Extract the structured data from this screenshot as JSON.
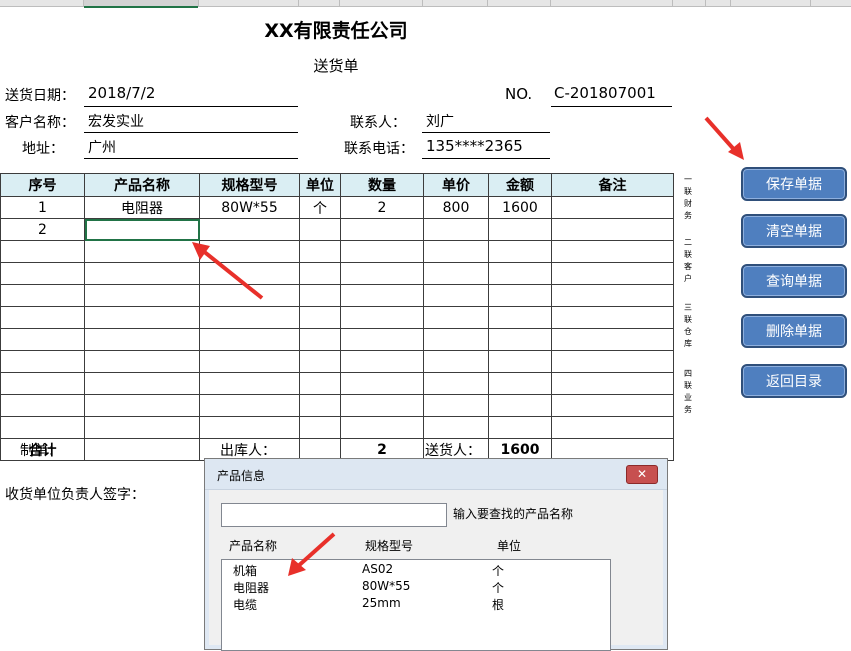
{
  "form": {
    "company": "XX有限责任公司",
    "doc_title": "送货单",
    "date_label": "送货日期：",
    "date_value": "2018/7/2",
    "no_label": "NO.",
    "no_value": "C-201807001",
    "customer_label": "客户名称：",
    "customer_value": "宏发实业",
    "contact_label": "联系人：",
    "contact_value": "刘广",
    "address_label": "地址：",
    "address_value": "广州",
    "phone_label": "联系电话：",
    "phone_value": "135****2365"
  },
  "table": {
    "headers": [
      "序号",
      "产品名称",
      "规格型号",
      "单位",
      "数量",
      "单价",
      "金额",
      "备注"
    ],
    "rows": [
      [
        "1",
        "电阻器",
        "80W*55",
        "个",
        "2",
        "800",
        "1600",
        ""
      ],
      [
        "2",
        "",
        "",
        "",
        "",
        "",
        "",
        ""
      ]
    ],
    "total_label": "合计",
    "total_qty": "2",
    "total_amount": "1600"
  },
  "side_labels": {
    "a": [
      "一",
      "联",
      "财",
      "务"
    ],
    "b": [
      "二",
      "联",
      "客",
      "户"
    ],
    "c": [
      "三",
      "联",
      "仓",
      "库"
    ],
    "d": [
      "四",
      "联",
      "业",
      "务"
    ]
  },
  "buttons": {
    "save": "保存单据",
    "clear": "清空单据",
    "query": "查询单据",
    "delete": "删除单据",
    "back": "返回目录"
  },
  "footer": {
    "maker": "制单：",
    "warehouse": "出库人：",
    "deliverer": "送货人：",
    "receiver_sign": "收货单位负责人签字："
  },
  "dialog": {
    "title": "产品信息",
    "close": "✕",
    "search_placeholder": "",
    "search_hint": "输入要查找的产品名称",
    "col_name": "产品名称",
    "col_spec": "规格型号",
    "col_unit": "单位",
    "items": [
      {
        "name": "机箱",
        "spec": "AS02",
        "unit": "个"
      },
      {
        "name": "电阻器",
        "spec": "80W*55",
        "unit": "个"
      },
      {
        "name": "电缆",
        "spec": "25mm",
        "unit": "根"
      }
    ]
  },
  "colors": {
    "header_fill": "#daeef3",
    "button_fill": "#4f7fbf",
    "arrow": "#e8302a",
    "selection": "#217346"
  }
}
